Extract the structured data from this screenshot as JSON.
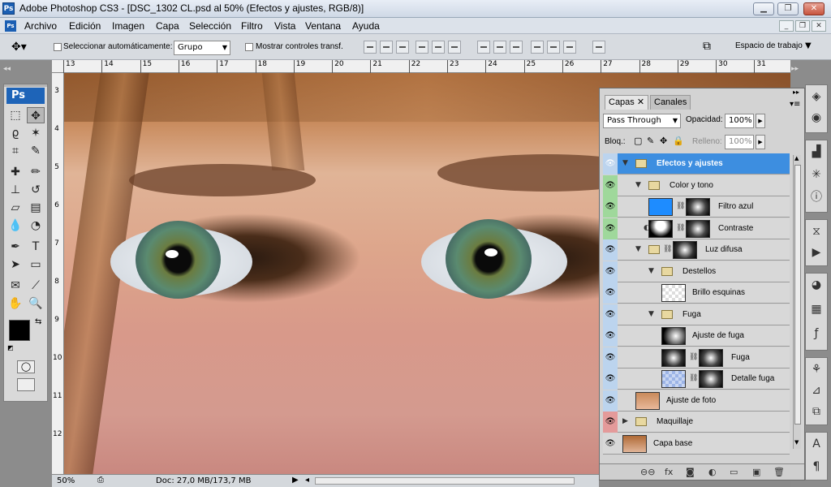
{
  "window": {
    "title": "Adobe Photoshop CS3 - [DSC_1302 CL.psd al 50% (Efectos y ajustes, RGB/8)]"
  },
  "menu": [
    "Archivo",
    "Edición",
    "Imagen",
    "Capa",
    "Selección",
    "Filtro",
    "Vista",
    "Ventana",
    "Ayuda"
  ],
  "options": {
    "auto_select_label": "Seleccionar automáticamente:",
    "auto_select_value": "Grupo",
    "show_transform_label": "Mostrar controles transf.",
    "workspace_label": "Espacio de trabajo"
  },
  "ruler_top": [
    "13",
    "14",
    "15",
    "16",
    "17",
    "18",
    "19",
    "20",
    "21",
    "22",
    "23",
    "24",
    "25",
    "26",
    "27",
    "28",
    "29",
    "30",
    "31"
  ],
  "ruler_left": [
    "3",
    "4",
    "5",
    "6",
    "7",
    "8",
    "9",
    "10",
    "11",
    "12"
  ],
  "status": {
    "zoom": "50%",
    "doc": "Doc: 27,0 MB/173,7 MB"
  },
  "layers_panel": {
    "tabs": [
      "Capas",
      "Canales"
    ],
    "blend_mode": "Pass Through",
    "opacity_label": "Opacidad:",
    "opacity_value": "100%",
    "lock_label": "Bloq.:",
    "fill_label": "Relleno:",
    "fill_value": "100%",
    "layers": [
      {
        "name": "Efectos y ajustes",
        "type": "group",
        "indent": 0,
        "selected": true,
        "eye": "blue"
      },
      {
        "name": "Color y tono",
        "type": "group",
        "indent": 1,
        "eye": "green"
      },
      {
        "name": "Filtro azul",
        "type": "adjustment",
        "indent": 2,
        "eye": "green"
      },
      {
        "name": "Contraste",
        "type": "adjustment",
        "indent": 2,
        "eye": "green"
      },
      {
        "name": "Luz difusa",
        "type": "group",
        "indent": 1,
        "eye": "blue"
      },
      {
        "name": "Destellos",
        "type": "group",
        "indent": 2,
        "eye": "blue"
      },
      {
        "name": "Brillo esquinas",
        "type": "layer",
        "indent": 3,
        "eye": "blue"
      },
      {
        "name": "Fuga",
        "type": "group",
        "indent": 2,
        "eye": "blue"
      },
      {
        "name": "Ajuste de fuga",
        "type": "layer",
        "indent": 3,
        "eye": "blue"
      },
      {
        "name": "Fuga",
        "type": "layer",
        "indent": 3,
        "eye": "blue"
      },
      {
        "name": "Detalle fuga",
        "type": "layer",
        "indent": 3,
        "eye": "blue"
      },
      {
        "name": "Ajuste de foto",
        "type": "layer",
        "indent": 1,
        "eye": "blue"
      },
      {
        "name": "Maquillaje",
        "type": "group",
        "indent": 0,
        "eye": "red"
      },
      {
        "name": "Capa base",
        "type": "layer",
        "indent": 0,
        "eye": "none"
      }
    ]
  },
  "colors": {
    "accent": "#3d8ee0",
    "panel_bg": "#d3d3d3",
    "workspace": "#8c8c8c"
  }
}
